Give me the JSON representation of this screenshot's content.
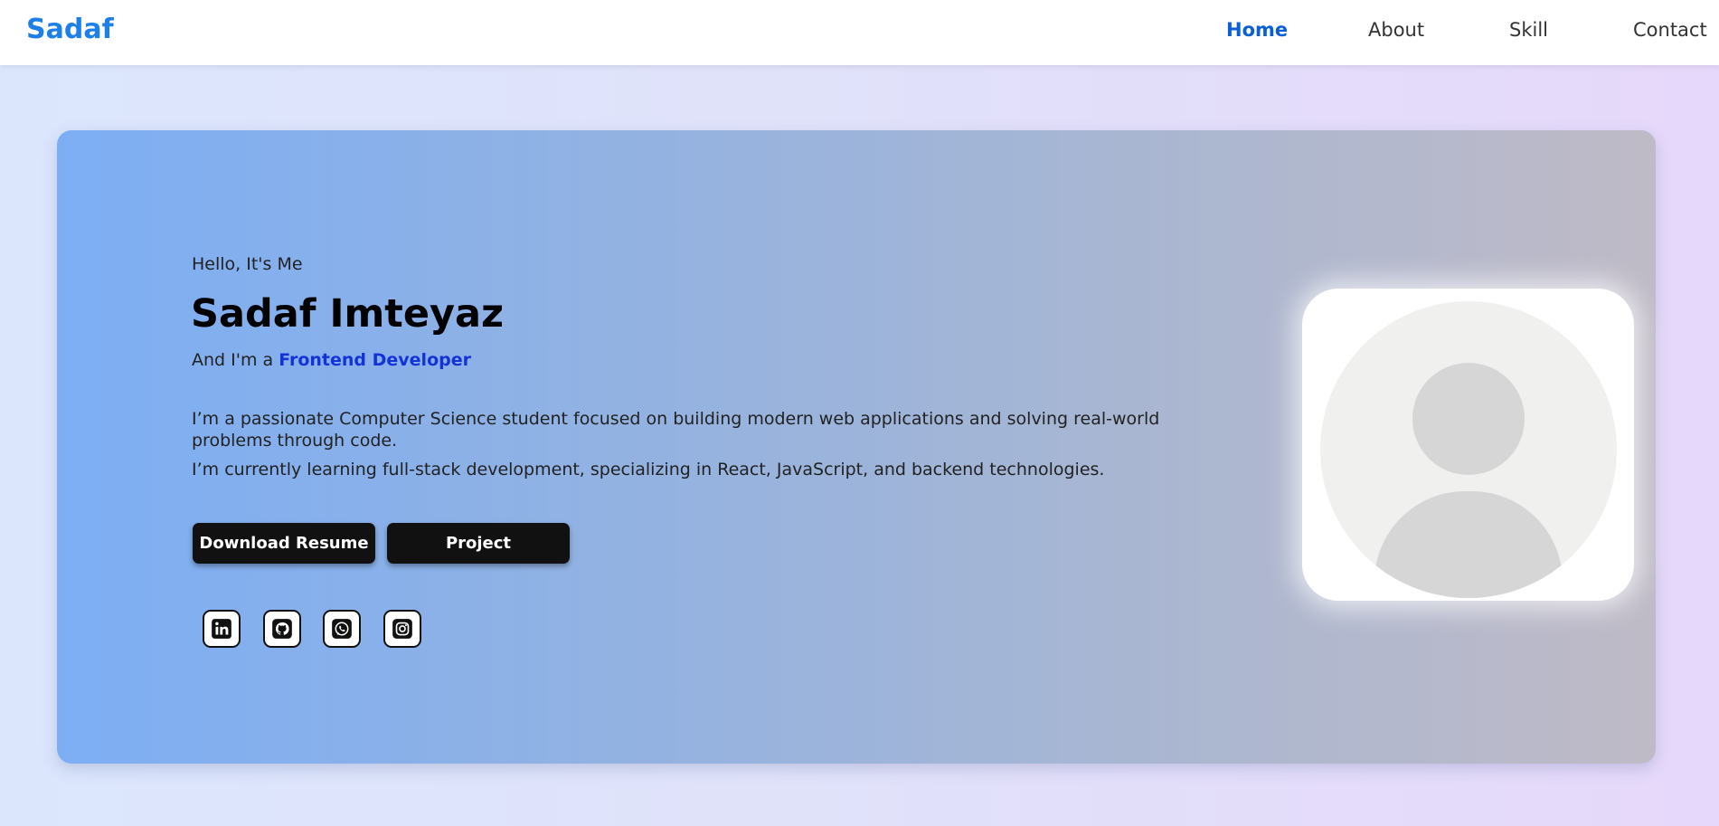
{
  "nav": {
    "logo": "Sadaf",
    "links": [
      {
        "label": "Home",
        "active": true
      },
      {
        "label": "About",
        "active": false
      },
      {
        "label": "Skill",
        "active": false
      },
      {
        "label": "Contact",
        "active": false
      }
    ]
  },
  "hero": {
    "greeting": "Hello, It's Me",
    "name": "Sadaf Imteyaz",
    "role_prefix": "And I'm a ",
    "role": "Frontend Developer",
    "bio": [
      "I’m a passionate Computer Science student focused on building modern web applications and solving real-world problems through code.",
      "I’m currently learning full-stack development, specializing in React, JavaScript, and backend technologies."
    ],
    "buttons": {
      "resume": "Download Resume",
      "project": "Project"
    },
    "social": [
      "linkedin-icon",
      "github-icon",
      "whatsapp-icon",
      "instagram-icon"
    ]
  },
  "colors": {
    "brand": "#1d7fe8",
    "nav_active": "#0a5fd6",
    "role_accent": "#1433d6",
    "button_bg": "#111111"
  }
}
